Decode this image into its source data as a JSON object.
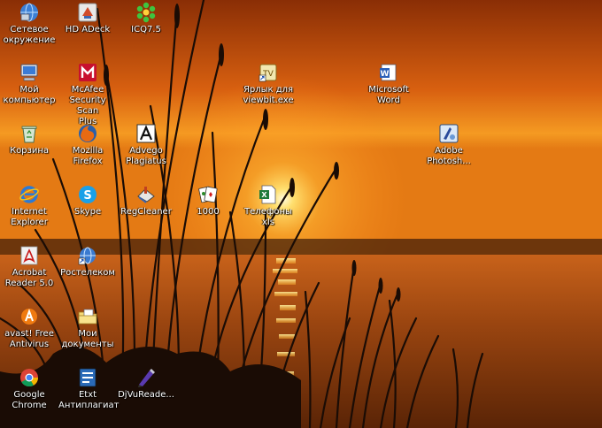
{
  "desktop": {
    "icons": [
      {
        "label": "Сетевое\nокружение",
        "icon": "network-icon"
      },
      {
        "label": "HD ADeck",
        "icon": "hd-adeck-icon"
      },
      {
        "label": "ICQ7.5",
        "icon": "icq-flower-icon"
      },
      {
        "label": "Мой\nкомпьютер",
        "icon": "my-computer-icon"
      },
      {
        "label": "McAfee\nSecurity Scan\nPlus",
        "icon": "mcafee-icon"
      },
      {
        "label": "Ярлык для\nviewbit.exe",
        "icon": "viewbit-shortcut-icon"
      },
      {
        "label": "Microsoft\nWord",
        "icon": "word-icon"
      },
      {
        "label": "Корзина",
        "icon": "recycle-bin-icon"
      },
      {
        "label": "Mozilla\nFirefox",
        "icon": "firefox-icon"
      },
      {
        "label": "Advego\nPlagiatus",
        "icon": "advego-icon"
      },
      {
        "label": "Adobe\nPhotosh...",
        "icon": "photoshop-icon"
      },
      {
        "label": "Internet\nExplorer",
        "icon": "internet-explorer-icon"
      },
      {
        "label": "Skype",
        "icon": "skype-icon"
      },
      {
        "label": "RegCleaner",
        "icon": "regcleaner-icon"
      },
      {
        "label": "1000",
        "icon": "cards-game-icon"
      },
      {
        "label": "Телефоны\nxls",
        "icon": "excel-file-icon"
      },
      {
        "label": "Acrobat\nReader 5.0",
        "icon": "acrobat-icon"
      },
      {
        "label": "Ростелеком",
        "icon": "rostelecom-icon"
      },
      {
        "label": "avast! Free\nAntivirus",
        "icon": "avast-icon"
      },
      {
        "label": "Мои\nдокументы",
        "icon": "my-documents-icon"
      },
      {
        "label": "Google\nChrome",
        "icon": "chrome-icon"
      },
      {
        "label": "Etxt\nАнтиплагиат",
        "icon": "etxt-icon"
      },
      {
        "label": "DjVuReade...",
        "icon": "djvu-reader-icon"
      }
    ]
  },
  "wallpaper": {
    "sky_top": "#b84a08",
    "sky_mid": "#f08a18",
    "sun": "#fff3b0",
    "water": "#8a3c0c",
    "reeds": "#1a0c05"
  }
}
